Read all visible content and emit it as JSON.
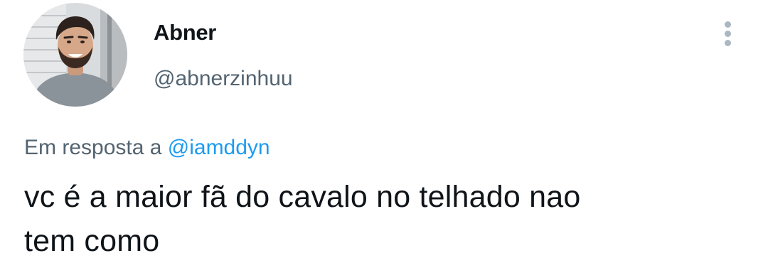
{
  "tweet": {
    "author": {
      "display_name": "Abner",
      "handle": "@abnerzinhuu",
      "avatar_icon": "profile-photo"
    },
    "more_icon": "more-vertical-icon",
    "reply_context": {
      "prefix": "Em resposta a",
      "mention": "@iamddyn"
    },
    "text_line1": "vc é a maior fã do cavalo no telhado nao",
    "text_line2": "tem como"
  },
  "colors": {
    "text_primary": "#0f1419",
    "text_secondary": "#536471",
    "link": "#1d9bf0",
    "more_dots": "#aab8c2"
  }
}
